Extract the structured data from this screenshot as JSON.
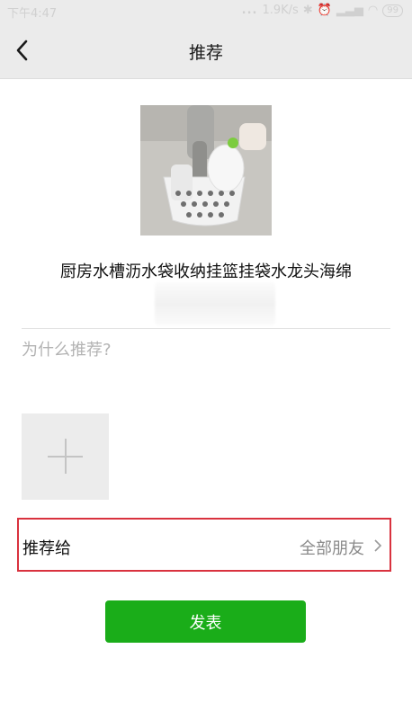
{
  "status_bar": {
    "time": "下午4:47",
    "dots": "...",
    "network_speed": "1.9K/s",
    "battery": "99"
  },
  "nav": {
    "title": "推荐",
    "back_icon": "chevron-left-icon"
  },
  "product": {
    "title": "厨房水槽沥水袋收纳挂篮挂袋水龙头海绵"
  },
  "reason": {
    "placeholder": "为什么推荐?"
  },
  "add_photo": {
    "icon": "plus-icon"
  },
  "recommend_to": {
    "label": "推荐给",
    "value": "全部朋友",
    "highlight_color": "#d9323e"
  },
  "publish": {
    "label": "发表",
    "color": "#1aad19"
  }
}
